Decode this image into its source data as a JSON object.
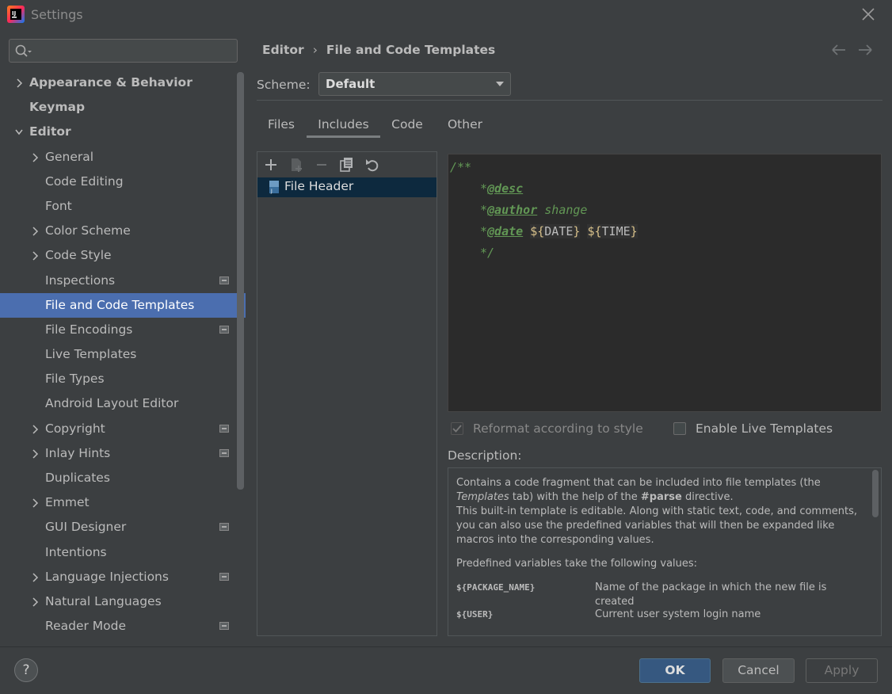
{
  "window": {
    "title": "Settings"
  },
  "search": {
    "placeholder": ""
  },
  "sidebar": {
    "items": [
      {
        "label": "Appearance & Behavior",
        "level": 0,
        "expandable": true,
        "expanded": false,
        "bold": true
      },
      {
        "label": "Keymap",
        "level": 0,
        "expandable": false,
        "bold": true
      },
      {
        "label": "Editor",
        "level": 0,
        "expandable": true,
        "expanded": true,
        "bold": true
      },
      {
        "label": "General",
        "level": 1,
        "expandable": true
      },
      {
        "label": "Code Editing",
        "level": 1
      },
      {
        "label": "Font",
        "level": 1
      },
      {
        "label": "Color Scheme",
        "level": 1,
        "expandable": true
      },
      {
        "label": "Code Style",
        "level": 1,
        "expandable": true
      },
      {
        "label": "Inspections",
        "level": 1,
        "badge": true
      },
      {
        "label": "File and Code Templates",
        "level": 1,
        "selected": true
      },
      {
        "label": "File Encodings",
        "level": 1,
        "badge": true
      },
      {
        "label": "Live Templates",
        "level": 1
      },
      {
        "label": "File Types",
        "level": 1
      },
      {
        "label": "Android Layout Editor",
        "level": 1
      },
      {
        "label": "Copyright",
        "level": 1,
        "expandable": true,
        "badge": true
      },
      {
        "label": "Inlay Hints",
        "level": 1,
        "expandable": true,
        "badge": true
      },
      {
        "label": "Duplicates",
        "level": 1
      },
      {
        "label": "Emmet",
        "level": 1,
        "expandable": true
      },
      {
        "label": "GUI Designer",
        "level": 1,
        "badge": true
      },
      {
        "label": "Intentions",
        "level": 1
      },
      {
        "label": "Language Injections",
        "level": 1,
        "expandable": true,
        "badge": true
      },
      {
        "label": "Natural Languages",
        "level": 1,
        "expandable": true
      },
      {
        "label": "Reader Mode",
        "level": 1,
        "badge": true
      }
    ]
  },
  "breadcrumb": {
    "parent": "Editor",
    "separator": "›",
    "current": "File and Code Templates"
  },
  "scheme": {
    "label": "Scheme:",
    "value": "Default"
  },
  "tabs": [
    {
      "label": "Files",
      "active": false
    },
    {
      "label": "Includes",
      "active": true
    },
    {
      "label": "Code",
      "active": false
    },
    {
      "label": "Other",
      "active": false
    }
  ],
  "templates": {
    "items": [
      {
        "label": "File Header",
        "selected": true
      }
    ]
  },
  "editor": {
    "line1": "/**",
    "line2_star": "*",
    "line2_tag": "@desc",
    "line3_star": "*",
    "line3_tag": "@author",
    "line3_text": " shange",
    "line4_star": "*",
    "line4_tag": "@date",
    "var1_open": "${",
    "var1_name": "DATE",
    "var1_close": "}",
    "var2_open": "${",
    "var2_name": "TIME",
    "var2_close": "}",
    "line5": "*/"
  },
  "options": {
    "reformat_label": "Reformat according to style",
    "reformat_checked": true,
    "reformat_enabled": false,
    "live_templates_label": "Enable Live Templates",
    "live_templates_checked": false
  },
  "description": {
    "label": "Description:",
    "p1_a": "Contains a code fragment that can be included into file templates (the ",
    "p1_italic": "Templates",
    "p1_b": " tab) with the help of the ",
    "p1_bold": "#parse",
    "p1_c": " directive.",
    "p1_d": "This built-in template is editable. Along with static text, code, and comments, you can also use the predefined variables that will then be expanded like macros into the corresponding values.",
    "p2": "Predefined variables take the following values:",
    "vars": [
      {
        "name": "${PACKAGE_NAME}",
        "desc": "Name of the package in which the new file is created"
      },
      {
        "name": "${USER}",
        "desc": "Current user system login name"
      }
    ]
  },
  "buttons": {
    "help": "?",
    "ok": "OK",
    "cancel": "Cancel",
    "apply": "Apply"
  },
  "colors": {
    "selection": "#4b6eaf",
    "ok_button": "#365880",
    "comment_green": "#629755",
    "brace_yellow": "#d7c08a"
  }
}
